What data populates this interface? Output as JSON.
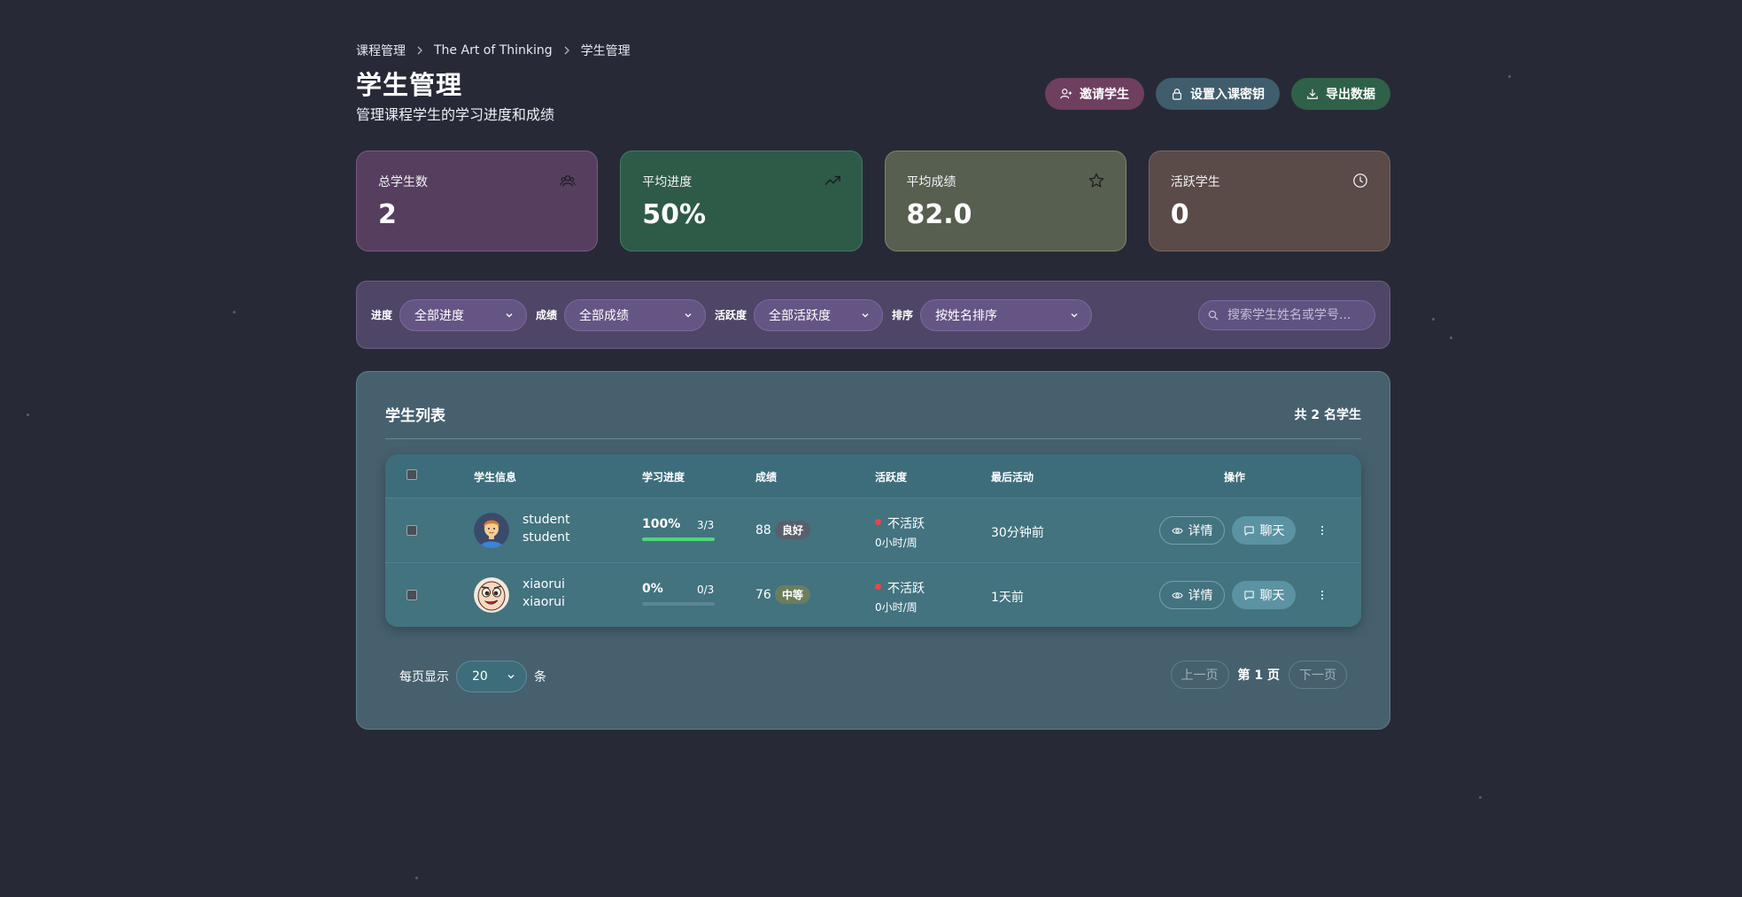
{
  "breadcrumb": [
    "课程管理",
    "The Art of Thinking",
    "学生管理"
  ],
  "page": {
    "title": "学生管理",
    "subtitle": "管理课程学生的学习进度和成绩"
  },
  "actions": {
    "invite": "邀请学生",
    "set_key": "设置入课密钥",
    "export": "导出数据"
  },
  "stats": [
    {
      "label": "总学生数",
      "value": "2",
      "icon": "users-icon"
    },
    {
      "label": "平均进度",
      "value": "50%",
      "icon": "trending-up-icon"
    },
    {
      "label": "平均成绩",
      "value": "82.0",
      "icon": "star-icon"
    },
    {
      "label": "活跃学生",
      "value": "0",
      "icon": "clock-icon"
    }
  ],
  "filters": {
    "progress_label": "进度",
    "progress_value": "全部进度",
    "score_label": "成绩",
    "score_value": "全部成绩",
    "activity_label": "活跃度",
    "activity_value": "全部活跃度",
    "sort_label": "排序",
    "sort_value": "按姓名排序",
    "search_placeholder": "搜索学生姓名或学号..."
  },
  "list": {
    "title": "学生列表",
    "count_text": "共 2 名学生",
    "columns": {
      "info": "学生信息",
      "progress": "学习进度",
      "score": "成绩",
      "activity": "活跃度",
      "last_active": "最后活动",
      "actions": "操作"
    },
    "rows": [
      {
        "name": "student",
        "id": "student",
        "progress_pct": "100%",
        "progress_count": "3/3",
        "progress_fraction": 1.0,
        "score": "88",
        "grade": "良好",
        "activity": "不活跃",
        "hours": "0小时/周",
        "last_active": "30分钟前",
        "detail": "详情",
        "chat": "聊天"
      },
      {
        "name": "xiaorui",
        "id": "xiaorui",
        "progress_pct": "0%",
        "progress_count": "0/3",
        "progress_fraction": 0.0,
        "score": "76",
        "grade": "中等",
        "activity": "不活跃",
        "hours": "0小时/周",
        "last_active": "1天前",
        "detail": "详情",
        "chat": "聊天"
      }
    ]
  },
  "pagination": {
    "per_page_label": "每页显示",
    "per_page_value": "20",
    "per_page_unit": "条",
    "prev": "上一页",
    "current": "第 1 页",
    "next": "下一页"
  },
  "colors": {
    "background": "#272a36",
    "progress_fill": "#4ed67a",
    "inactive_dot": "#ef4444"
  }
}
